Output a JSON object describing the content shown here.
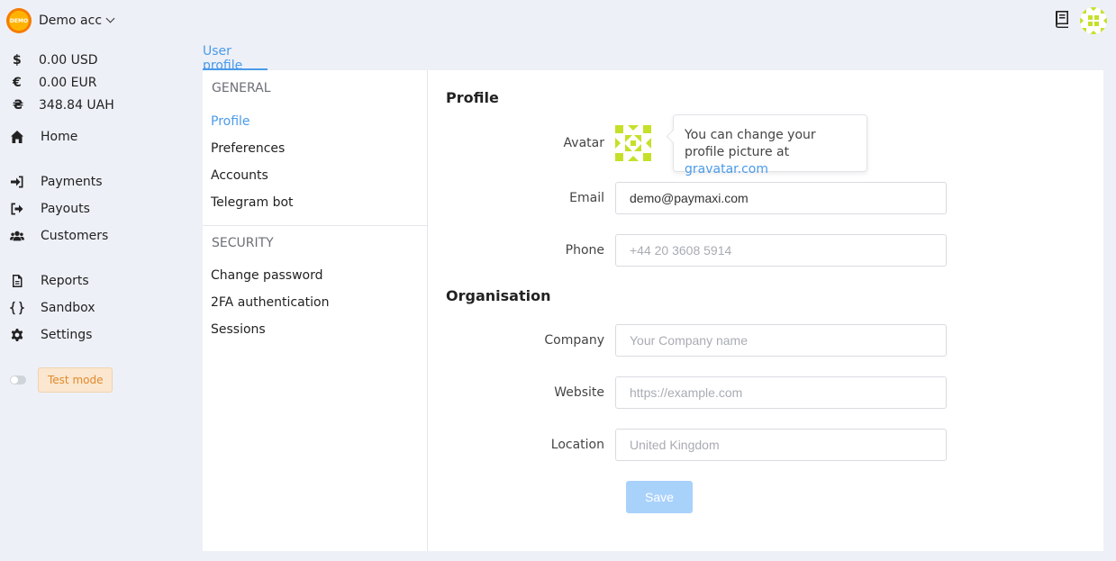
{
  "account": {
    "logo_text": "DEMO",
    "name": "Demo acc"
  },
  "balances": [
    {
      "symbol": "$",
      "value": "0.00 USD"
    },
    {
      "symbol": "€",
      "value": "0.00 EUR"
    },
    {
      "symbol": "₴",
      "value": "348.84 UAH"
    }
  ],
  "nav": {
    "home": "Home",
    "payments": "Payments",
    "payouts": "Payouts",
    "customers": "Customers",
    "reports": "Reports",
    "sandbox": "Sandbox",
    "settings": "Settings"
  },
  "test_mode": {
    "label": "Test mode",
    "enabled": false
  },
  "tab": {
    "label": "User profile"
  },
  "subnav": {
    "general_title": "GENERAL",
    "general_items": [
      "Profile",
      "Preferences",
      "Accounts",
      "Telegram bot"
    ],
    "security_title": "SECURITY",
    "security_items": [
      "Change password",
      "2FA authentication",
      "Sessions"
    ]
  },
  "profile": {
    "title": "Profile",
    "avatar_label": "Avatar",
    "tooltip_text": "You can change your profile picture at",
    "tooltip_link": "gravatar.com",
    "email_label": "Email",
    "email_value": "demo@paymaxi.com",
    "phone_label": "Phone",
    "phone_placeholder": "+44 20 3608 5914"
  },
  "organisation": {
    "title": "Organisation",
    "company_label": "Company",
    "company_placeholder": "Your Company name",
    "website_label": "Website",
    "website_placeholder": "https://example.com",
    "location_label": "Location",
    "location_placeholder": "United Kingdom"
  },
  "save_label": "Save",
  "colors": {
    "accent": "#4a9be9",
    "save_disabled": "#a9d2fb",
    "test_badge": "#fbe6cf",
    "avatar": "#c6e02a"
  },
  "icons": {
    "header": [
      "book-icon",
      "user-avatar"
    ],
    "nav": [
      "home-icon",
      "sign-in-icon",
      "sign-out-icon",
      "users-icon",
      "file-icon",
      "braces-icon",
      "gear-icon"
    ]
  }
}
